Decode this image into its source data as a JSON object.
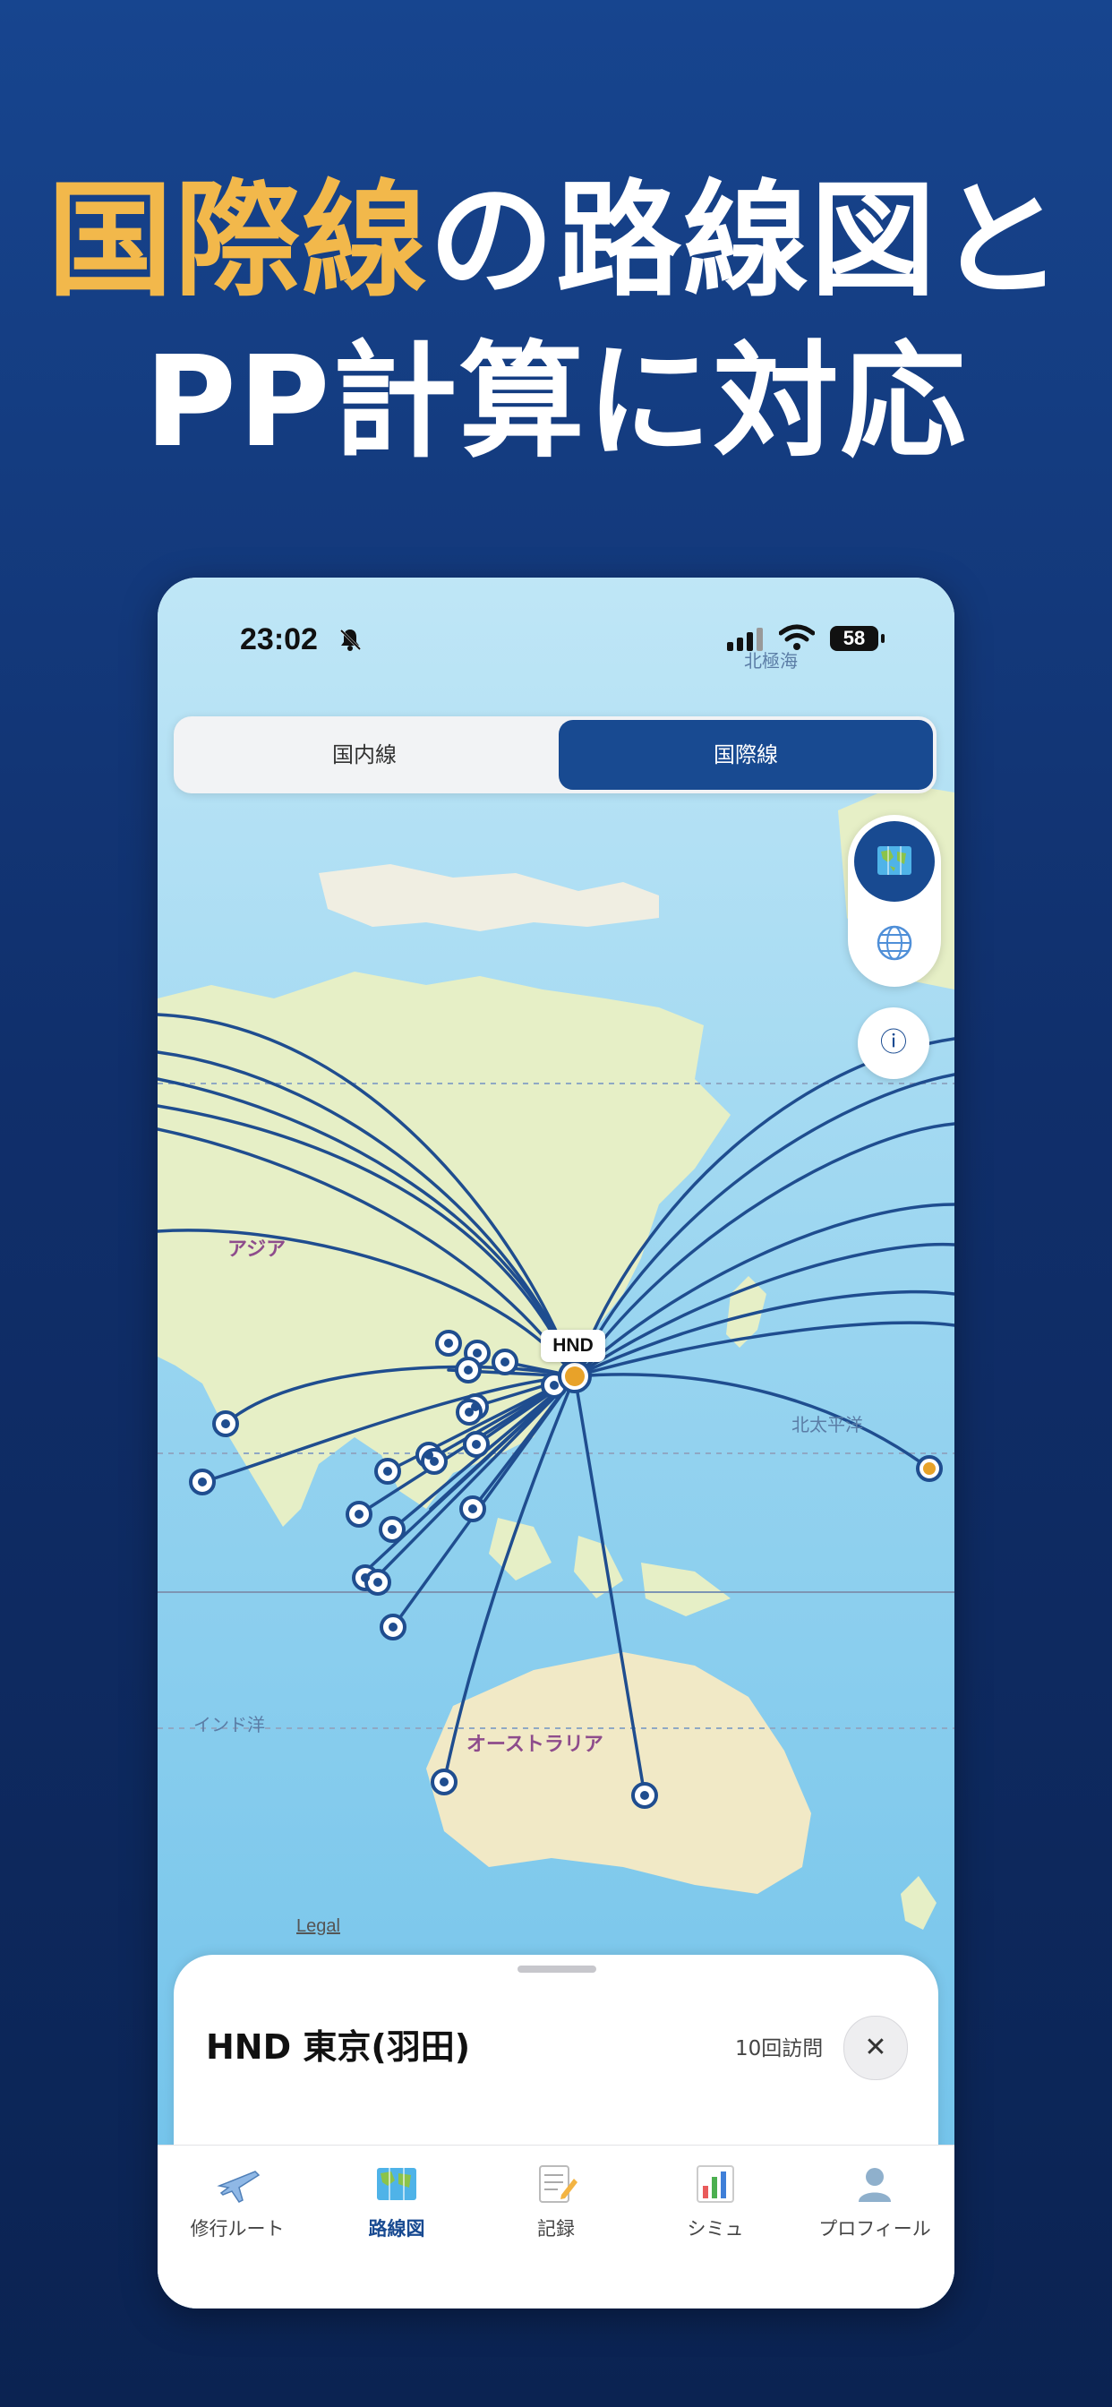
{
  "headline": {
    "line1_accent": "国際線",
    "line1_rest": "の路線図と",
    "line2": "PP計算に対応"
  },
  "status_bar": {
    "time": "23:02",
    "battery": "58"
  },
  "segment": {
    "domestic": "国内線",
    "international": "国際線",
    "selected": "international"
  },
  "map": {
    "labels": {
      "asia": "アジア",
      "australia": "オーストラリア",
      "north_pacific": "北太平洋",
      "indian_ocean": "インド洋",
      "bering_sea": "北極海"
    },
    "hub_code": "HND",
    "legal": "Legal"
  },
  "sheet": {
    "title": "HND 東京(羽田)",
    "visits": "10回訪問"
  },
  "tabs": [
    {
      "label": "修行ルート",
      "icon": "airplane-icon"
    },
    {
      "label": "路線図",
      "icon": "map-icon"
    },
    {
      "label": "記録",
      "icon": "memo-icon"
    },
    {
      "label": "シミュ",
      "icon": "bar-chart-icon"
    },
    {
      "label": "プロフィール",
      "icon": "profile-icon"
    }
  ],
  "colors": {
    "accent": "#f2b84b",
    "brand": "#184a91",
    "route": "#1f4d8f",
    "hub": "#e8a229"
  }
}
